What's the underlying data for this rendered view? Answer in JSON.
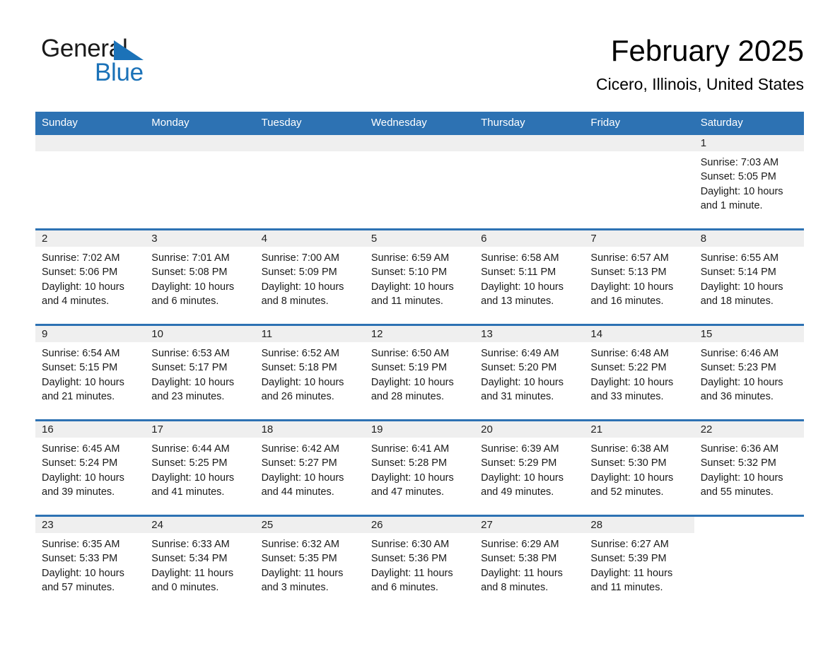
{
  "brand": {
    "word1": "General",
    "word2": "Blue",
    "triangle_color": "#1b72b8"
  },
  "header": {
    "title": "February 2025",
    "subtitle": "Cicero, Illinois, United States"
  },
  "theme": {
    "header_blue": "#2d72b3",
    "daynum_gray": "#efefef",
    "text": "#1a1a1a",
    "page_background": "#ffffff"
  },
  "calendar": {
    "weekdays": [
      "Sunday",
      "Monday",
      "Tuesday",
      "Wednesday",
      "Thursday",
      "Friday",
      "Saturday"
    ],
    "weeks": [
      [
        {
          "day": "",
          "empty": true
        },
        {
          "day": "",
          "empty": true
        },
        {
          "day": "",
          "empty": true
        },
        {
          "day": "",
          "empty": true
        },
        {
          "day": "",
          "empty": true
        },
        {
          "day": "",
          "empty": true
        },
        {
          "day": "1",
          "sunrise": "Sunrise: 7:03 AM",
          "sunset": "Sunset: 5:05 PM",
          "daylight": "Daylight: 10 hours and 1 minute."
        }
      ],
      [
        {
          "day": "2",
          "sunrise": "Sunrise: 7:02 AM",
          "sunset": "Sunset: 5:06 PM",
          "daylight": "Daylight: 10 hours and 4 minutes."
        },
        {
          "day": "3",
          "sunrise": "Sunrise: 7:01 AM",
          "sunset": "Sunset: 5:08 PM",
          "daylight": "Daylight: 10 hours and 6 minutes."
        },
        {
          "day": "4",
          "sunrise": "Sunrise: 7:00 AM",
          "sunset": "Sunset: 5:09 PM",
          "daylight": "Daylight: 10 hours and 8 minutes."
        },
        {
          "day": "5",
          "sunrise": "Sunrise: 6:59 AM",
          "sunset": "Sunset: 5:10 PM",
          "daylight": "Daylight: 10 hours and 11 minutes."
        },
        {
          "day": "6",
          "sunrise": "Sunrise: 6:58 AM",
          "sunset": "Sunset: 5:11 PM",
          "daylight": "Daylight: 10 hours and 13 minutes."
        },
        {
          "day": "7",
          "sunrise": "Sunrise: 6:57 AM",
          "sunset": "Sunset: 5:13 PM",
          "daylight": "Daylight: 10 hours and 16 minutes."
        },
        {
          "day": "8",
          "sunrise": "Sunrise: 6:55 AM",
          "sunset": "Sunset: 5:14 PM",
          "daylight": "Daylight: 10 hours and 18 minutes."
        }
      ],
      [
        {
          "day": "9",
          "sunrise": "Sunrise: 6:54 AM",
          "sunset": "Sunset: 5:15 PM",
          "daylight": "Daylight: 10 hours and 21 minutes."
        },
        {
          "day": "10",
          "sunrise": "Sunrise: 6:53 AM",
          "sunset": "Sunset: 5:17 PM",
          "daylight": "Daylight: 10 hours and 23 minutes."
        },
        {
          "day": "11",
          "sunrise": "Sunrise: 6:52 AM",
          "sunset": "Sunset: 5:18 PM",
          "daylight": "Daylight: 10 hours and 26 minutes."
        },
        {
          "day": "12",
          "sunrise": "Sunrise: 6:50 AM",
          "sunset": "Sunset: 5:19 PM",
          "daylight": "Daylight: 10 hours and 28 minutes."
        },
        {
          "day": "13",
          "sunrise": "Sunrise: 6:49 AM",
          "sunset": "Sunset: 5:20 PM",
          "daylight": "Daylight: 10 hours and 31 minutes."
        },
        {
          "day": "14",
          "sunrise": "Sunrise: 6:48 AM",
          "sunset": "Sunset: 5:22 PM",
          "daylight": "Daylight: 10 hours and 33 minutes."
        },
        {
          "day": "15",
          "sunrise": "Sunrise: 6:46 AM",
          "sunset": "Sunset: 5:23 PM",
          "daylight": "Daylight: 10 hours and 36 minutes."
        }
      ],
      [
        {
          "day": "16",
          "sunrise": "Sunrise: 6:45 AM",
          "sunset": "Sunset: 5:24 PM",
          "daylight": "Daylight: 10 hours and 39 minutes."
        },
        {
          "day": "17",
          "sunrise": "Sunrise: 6:44 AM",
          "sunset": "Sunset: 5:25 PM",
          "daylight": "Daylight: 10 hours and 41 minutes."
        },
        {
          "day": "18",
          "sunrise": "Sunrise: 6:42 AM",
          "sunset": "Sunset: 5:27 PM",
          "daylight": "Daylight: 10 hours and 44 minutes."
        },
        {
          "day": "19",
          "sunrise": "Sunrise: 6:41 AM",
          "sunset": "Sunset: 5:28 PM",
          "daylight": "Daylight: 10 hours and 47 minutes."
        },
        {
          "day": "20",
          "sunrise": "Sunrise: 6:39 AM",
          "sunset": "Sunset: 5:29 PM",
          "daylight": "Daylight: 10 hours and 49 minutes."
        },
        {
          "day": "21",
          "sunrise": "Sunrise: 6:38 AM",
          "sunset": "Sunset: 5:30 PM",
          "daylight": "Daylight: 10 hours and 52 minutes."
        },
        {
          "day": "22",
          "sunrise": "Sunrise: 6:36 AM",
          "sunset": "Sunset: 5:32 PM",
          "daylight": "Daylight: 10 hours and 55 minutes."
        }
      ],
      [
        {
          "day": "23",
          "sunrise": "Sunrise: 6:35 AM",
          "sunset": "Sunset: 5:33 PM",
          "daylight": "Daylight: 10 hours and 57 minutes."
        },
        {
          "day": "24",
          "sunrise": "Sunrise: 6:33 AM",
          "sunset": "Sunset: 5:34 PM",
          "daylight": "Daylight: 11 hours and 0 minutes."
        },
        {
          "day": "25",
          "sunrise": "Sunrise: 6:32 AM",
          "sunset": "Sunset: 5:35 PM",
          "daylight": "Daylight: 11 hours and 3 minutes."
        },
        {
          "day": "26",
          "sunrise": "Sunrise: 6:30 AM",
          "sunset": "Sunset: 5:36 PM",
          "daylight": "Daylight: 11 hours and 6 minutes."
        },
        {
          "day": "27",
          "sunrise": "Sunrise: 6:29 AM",
          "sunset": "Sunset: 5:38 PM",
          "daylight": "Daylight: 11 hours and 8 minutes."
        },
        {
          "day": "28",
          "sunrise": "Sunrise: 6:27 AM",
          "sunset": "Sunset: 5:39 PM",
          "daylight": "Daylight: 11 hours and 11 minutes."
        },
        {
          "day": "",
          "empty": true,
          "blank_white": true
        }
      ]
    ]
  }
}
